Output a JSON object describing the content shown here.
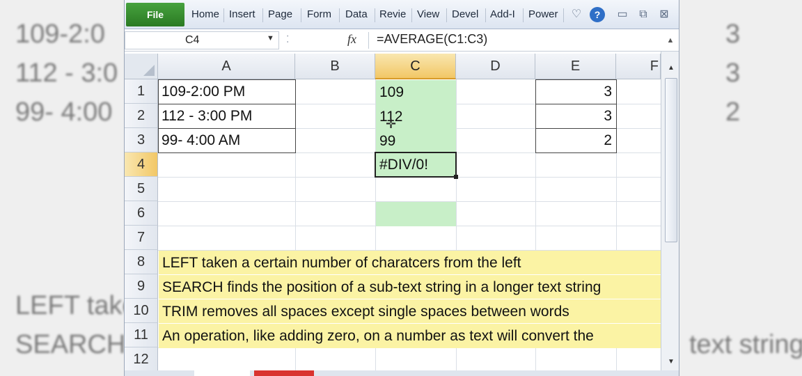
{
  "background": {
    "left_lines": [
      "109-2:0",
      "112 - 3:0",
      "99- 4:00",
      "LEFT take",
      "SEARCH"
    ],
    "right_lines": [
      "3",
      "3",
      "2",
      "text string"
    ]
  },
  "ribbon": {
    "file_tab": "File",
    "tabs": [
      "Home",
      "Insert",
      "Page",
      "Form",
      "Data",
      "Revie",
      "View",
      "Devel",
      "Add-I",
      "Power"
    ],
    "icons": [
      "heart-icon",
      "help-icon",
      "minimize-icon",
      "restore-icon",
      "close-icon"
    ],
    "help_glyph": "?"
  },
  "formula_bar": {
    "name_box": "C4",
    "fx_label": "fx",
    "formula": "=AVERAGE(C1:C3)"
  },
  "grid": {
    "columns": [
      "A",
      "B",
      "C",
      "D",
      "E",
      "F"
    ],
    "rows": [
      "1",
      "2",
      "3",
      "4",
      "5",
      "6",
      "7",
      "8",
      "9",
      "10",
      "11",
      "12"
    ],
    "selected_column": "C",
    "selected_row": "4",
    "cells": {
      "A1": "109-2:00 PM",
      "A2": "112 - 3:00 PM",
      "A3": "99- 4:00 AM",
      "C1": "109",
      "C2": "112",
      "C3": "99",
      "C4": "#DIV/0!",
      "E1": "3",
      "E2": "3",
      "E3": "2",
      "A8": "LEFT taken a certain number of charatcers from the left",
      "A9": "SEARCH finds the position of a sub-text string in a longer text string",
      "A10": "TRIM removes all spaces except single spaces between words",
      "A11": "An operation, like adding zero, on a number as text will convert the"
    }
  },
  "colors": {
    "green_fill": "#c8efc8",
    "yellow_fill": "#fbf3a4",
    "file_tab": "#2a7a22",
    "selected_header": "#f2c766"
  }
}
